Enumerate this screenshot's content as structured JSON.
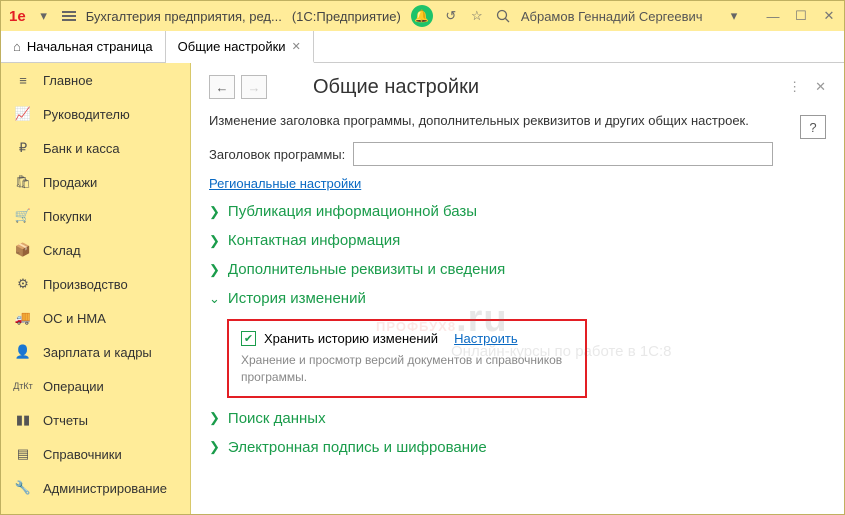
{
  "titlebar": {
    "app_title": "Бухгалтерия предприятия, ред...",
    "platform": "(1С:Предприятие)",
    "user": "Абрамов Геннадий Сергеевич"
  },
  "tabs": {
    "home": "Начальная страница",
    "active": "Общие настройки"
  },
  "sidebar": {
    "items": [
      "Главное",
      "Руководителю",
      "Банк и касса",
      "Продажи",
      "Покупки",
      "Склад",
      "Производство",
      "ОС и НМА",
      "Зарплата и кадры",
      "Операции",
      "Отчеты",
      "Справочники",
      "Администрирование"
    ]
  },
  "main": {
    "title": "Общие настройки",
    "description": "Изменение заголовка программы, дополнительных реквизитов и других общих настроек.",
    "field_label": "Заголовок программы:",
    "field_value": "",
    "regional_link": "Региональные настройки",
    "sections": {
      "s1": "Публикация информационной базы",
      "s2": "Контактная информация",
      "s3": "Дополнительные реквизиты и сведения",
      "s4": "История изменений",
      "s5": "Поиск данных",
      "s6": "Электронная подпись и шифрование"
    },
    "history": {
      "checkbox_label": "Хранить историю изменений",
      "configure_link": "Настроить",
      "hint": "Хранение и просмотр версий документов и справочников программы."
    }
  },
  "watermark": {
    "main": "ПРОФБУХ8",
    "suffix": ".ru",
    "sub": "Онлайн-курсы по работе в 1С:8"
  }
}
